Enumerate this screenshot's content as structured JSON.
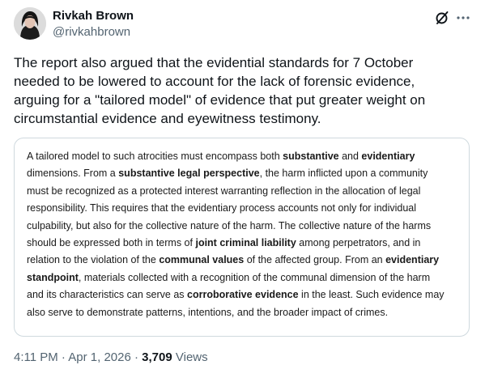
{
  "author": {
    "name": "Rivkah Brown",
    "handle": "@rivkahbrown"
  },
  "icons": {
    "avatar": "avatar-photo",
    "grok": "grok-slash-icon",
    "more": "more-horizontal-icon"
  },
  "tweet": {
    "lines": [
      "The report also argued that the evidential standards for 7 October",
      "needed to be lowered to account for the lack of forensic evidence,",
      "arguing for a \"tailored model\" of evidence that put greater weight on",
      "circumstantial evidence and eyewitness testimony."
    ]
  },
  "quote": {
    "l1a": "A tailored model to such atrocities must encompass both ",
    "l1b": "substantive",
    "l1c": " and ",
    "l1d": "evidentiary",
    "l2a": "dimensions. From a ",
    "l2b": "substantive legal perspective",
    "l2c": ", the harm inflicted upon a community",
    "l3": "must be recognized as a protected interest warranting reflection in the allocation of legal",
    "l4": "responsibility. This requires that the evidentiary process accounts not only for individual",
    "l5": "culpability, but also for the collective nature of the harm. The collective nature of the harms",
    "l6a": "should be expressed both in terms of ",
    "l6b": "joint criminal liability",
    "l6c": " among perpetrators, and in",
    "l7a": "relation to the violation of the ",
    "l7b": "communal values",
    "l7c": " of the affected group. From an ",
    "l7d": "evidentiary",
    "l8a": "standpoint",
    "l8b": ", materials collected with a recognition of the communal dimension of the harm",
    "l9a": "and its characteristics can serve as ",
    "l9b": "corroborative evidence",
    "l9c": " in the least. Such evidence may",
    "l10": "also serve to demonstrate patterns, intentions, and the broader impact of crimes."
  },
  "meta": {
    "time": "4:11 PM",
    "sep1": " · ",
    "date": "Apr 1, 2026",
    "sep2": " · ",
    "views_count": "3,709",
    "views_label": " Views"
  }
}
